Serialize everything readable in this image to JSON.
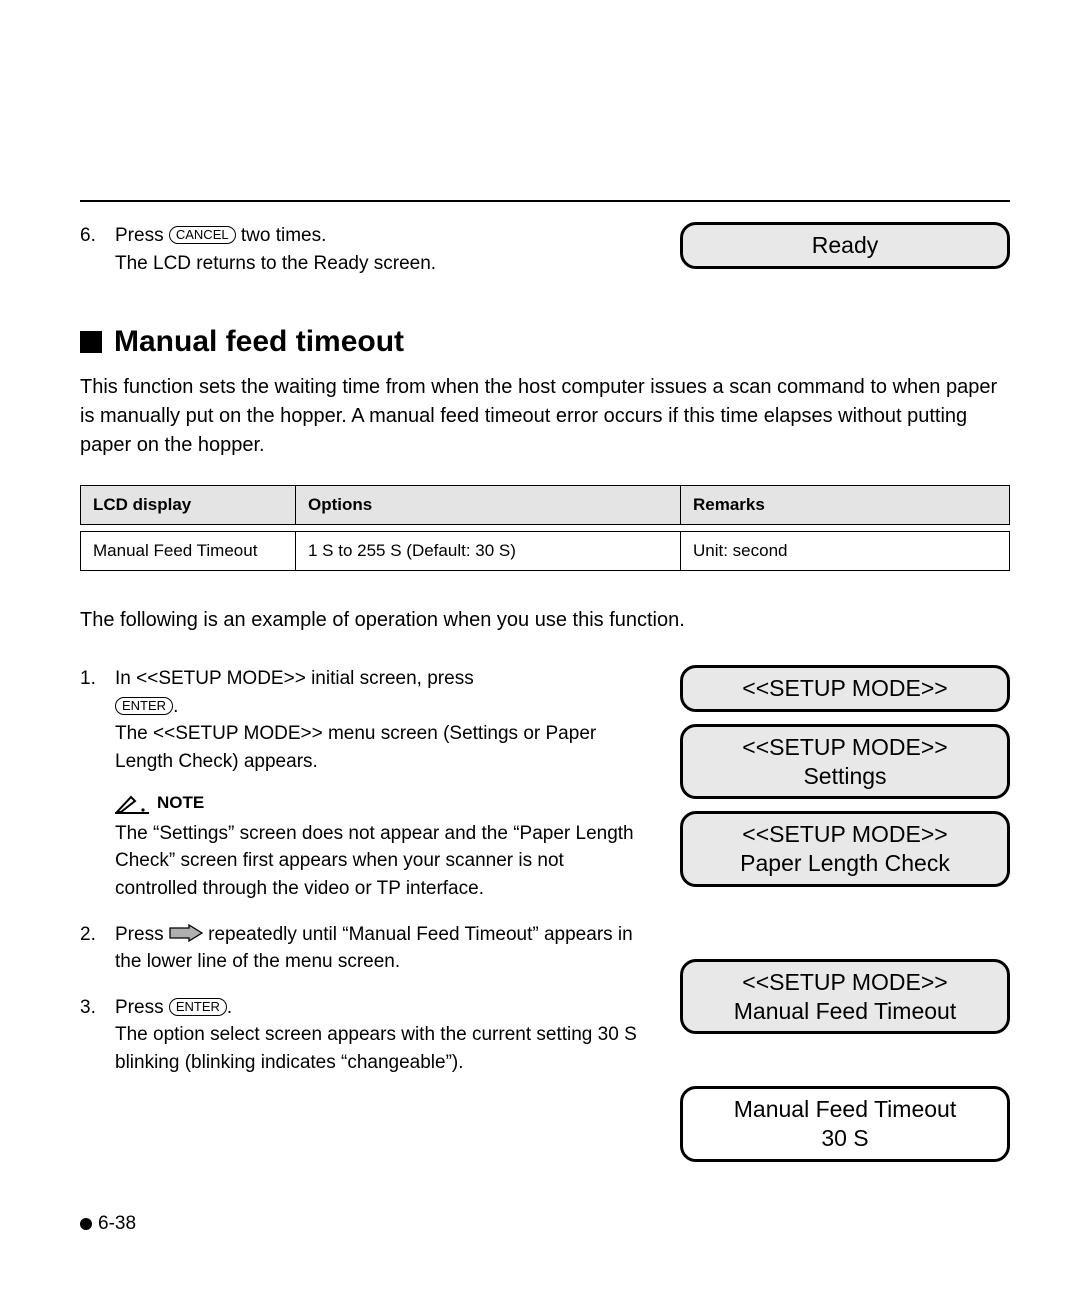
{
  "top": {
    "step6": {
      "num": "6.",
      "press": "Press",
      "cancel_btn": "CANCEL",
      "two_times": " two times.",
      "line2": "The LCD returns to the Ready screen."
    },
    "lcd_ready": "Ready"
  },
  "section": {
    "title": "Manual feed timeout",
    "intro": "This function sets the waiting time from when the host computer issues a scan command to when paper is manually put on the hopper.  A manual feed timeout error occurs if this time elapses without putting paper on the hopper."
  },
  "table": {
    "h1": "LCD display",
    "h2": "Options",
    "h3": "Remarks",
    "r1c1": "Manual Feed Timeout",
    "r1c2": "1 S to 255 S (Default: 30 S)",
    "r1c3": "Unit:  second"
  },
  "example_intro": "The following is an example of operation when you use this function.",
  "steps": {
    "s1": {
      "num": "1.",
      "line1a": "In <<SETUP MODE>> initial screen, press",
      "enter_btn": "ENTER",
      "dot": ".",
      "line2": "The <<SETUP MODE>> menu screen (Settings or Paper Length Check) appears."
    },
    "note": {
      "label": "NOTE",
      "text": "The “Settings” screen does not appear and the “Paper Length Check” screen first appears when your scanner is not controlled through the video or TP interface."
    },
    "s2": {
      "num": "2.",
      "press": "Press ",
      "rest": " repeatedly until “Manual Feed Timeout” appears in the lower line of the menu screen."
    },
    "s3": {
      "num": "3.",
      "press": "Press ",
      "enter_btn": "ENTER",
      "dot": ".",
      "line2": "The option select screen appears with the current setting 30 S blinking (blinking indicates “changeable”)."
    }
  },
  "lcds": {
    "setup1": "<<SETUP MODE>>",
    "setup2a": "<<SETUP MODE>>",
    "setup2b": "Settings",
    "setup3a": "<<SETUP MODE>>",
    "setup3b": "Paper Length Check",
    "setup4a": "<<SETUP MODE>>",
    "setup4b": "Manual Feed Timeout",
    "setup5a": "Manual Feed Timeout",
    "setup5b": "30 S"
  },
  "footer": {
    "page": "6-38"
  }
}
